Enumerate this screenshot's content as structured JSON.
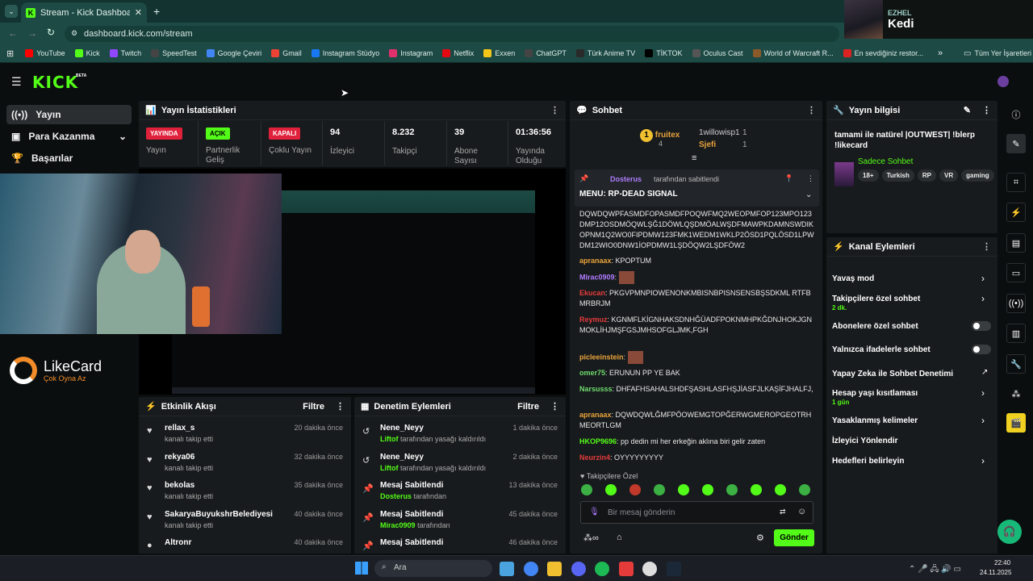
{
  "browser": {
    "tab_title": "Stream - Kick Dashboard",
    "url": "dashboard.kick.com/stream",
    "bookmarks": [
      "YouTube",
      "Kick",
      "Twitch",
      "SpeedTest",
      "Google Çeviri",
      "Gmail",
      "Instagram Stüdyo",
      "Instagram",
      "Netflix",
      "Exxen",
      "ChatGPT",
      "Türk Anime TV",
      "TİKTOK",
      "Oculus Cast",
      "World of Warcraft R...",
      "En sevdiğiniz restor..."
    ],
    "all_bookmarks": "Tüm Yer İşaretleri"
  },
  "media": {
    "artist": "EZHEL",
    "title": "Kedi"
  },
  "kick": {
    "logo": "KICK",
    "beta": "BETA"
  },
  "nav": {
    "items": [
      "Yayın",
      "Para Kazanma",
      "Başarılar"
    ]
  },
  "stats": {
    "title": "Yayın İstatistikleri",
    "badges": [
      {
        "text": "YAYINDA",
        "label": "Yayın"
      },
      {
        "text": "AÇIK",
        "label": "Partnerlik Geliş"
      },
      {
        "text": "KAPALI",
        "label": "Çoklu Yayın"
      }
    ],
    "items": [
      {
        "value": "94",
        "label": "İzleyici"
      },
      {
        "value": "8.232",
        "label": "Takipçi"
      },
      {
        "value": "39",
        "label": "Abone Sayısı"
      },
      {
        "value": "01:36:56",
        "label": "Yayında Olduğu"
      }
    ]
  },
  "overlay": {
    "brand": "LikeCard",
    "tagline": "Çok Oyna  Az"
  },
  "activity": {
    "title": "Etkinlik Akışı",
    "filter": "Filtre",
    "rows": [
      {
        "name": "rellax_s",
        "sub": "kanalı takip etti",
        "time": "20 dakika önce"
      },
      {
        "name": "rekya06",
        "sub": "kanalı takip etti",
        "time": "32 dakika önce"
      },
      {
        "name": "bekolas",
        "sub": "kanalı takip etti",
        "time": "35 dakika önce"
      },
      {
        "name": "SakaryaBuyukshrBelediyesi",
        "sub": "kanalı takip etti",
        "time": "40 dakika önce"
      },
      {
        "name": "Altronr",
        "sub": "",
        "time": "40 dakika önce"
      }
    ]
  },
  "moderation": {
    "title": "Denetim Eylemleri",
    "filter": "Filtre",
    "rows": [
      {
        "name": "Nene_Neyy",
        "actor": "Liftof",
        "sub": "tarafından yasağı kaldırıldı",
        "time": "1 dakika önce"
      },
      {
        "name": "Nene_Neyy",
        "actor": "Liftof",
        "sub": "tarafından yasağı kaldırıldı",
        "time": "2 dakika önce"
      },
      {
        "name": "Mesaj Sabitlendi",
        "actor": "Dosterus",
        "sub": "tarafından",
        "time": "13 dakika önce"
      },
      {
        "name": "Mesaj Sabitlendi",
        "actor": "Mirac0909",
        "sub": "tarafından",
        "time": "45 dakika önce"
      },
      {
        "name": "Mesaj Sabitlendi",
        "actor": "",
        "sub": "",
        "time": "46 dakika önce"
      }
    ]
  },
  "chat": {
    "title": "Sohbet",
    "top": [
      {
        "name": "fruitex",
        "count": "4"
      },
      {
        "name": "1willowisp1",
        "count": "1"
      },
      {
        "name": "Sjefi",
        "count": "1"
      }
    ],
    "pinned": {
      "by": "Dosterus",
      "by_text": "tarafından sabitlendi",
      "text": "MENU: RP-DEAD SIGNAL"
    },
    "messages": [
      {
        "user": "",
        "text": "DQWDQWPFASMDFOPASMDFPOQWFMQ2WEOPMFOP123MPO123DMP12OSDMÖQWLŞĞ1DÖWLQŞDMÖALWŞDFMAWPKDAMNSWDIKOPNM1Q2WO0FIPDMW123FMK1WEDM1WKLP2ÖSD1PQLÖSD1LPWDM12WIO0DNW1İOPDMW1LŞDÖQW2LŞDFÖW2",
        "color": "#e8e8e8"
      },
      {
        "user": "apranaax",
        "text": "KPOPTUM",
        "color": "#e8a33c"
      },
      {
        "user": "Mirac0909",
        "text": "",
        "color": "#b07cff"
      },
      {
        "user": "Ekucan",
        "text": "PKGVPMNPIOWENONKMBISNBPISNSENSBŞSDKML RTFBMRBRJM",
        "color": "#e53b3b"
      },
      {
        "user": "Reymuz",
        "text": "KGNMFLKİGNHAKSDNHĞÜADFPOKNMHPKĞDNJHOKJGNMOKLİHJMŞFGSJMHSOFGLJMK,FGH",
        "color": "#e53b3b"
      },
      {
        "user": "picleeinstein",
        "text": "",
        "color": "#e8a33c"
      },
      {
        "user": "omer75",
        "text": "ERUNUN PP YE BAK",
        "color": "#6fdc6f"
      },
      {
        "user": "Narsusss",
        "text": "DHFAFHSAHALSHDFŞASHLASFHŞJİASFJLKAŞİFJHALFJ,",
        "color": "#6fdc6f"
      },
      {
        "user": "apranaax",
        "text": "DQWDQWLĞMFPÖOWEMGTOPĞERWGMEROPGEOTRHMEORTLGM",
        "color": "#e8a33c"
      },
      {
        "user": "HKOP9696",
        "text": "pp dedin mi her erkeğin aklına biri gelir zaten",
        "color": "#53fc18"
      },
      {
        "user": "Neurzin4",
        "text": "OYYYYYYYYY",
        "color": "#e53b3b"
      }
    ],
    "followers_only": "Takipçilere Özel",
    "placeholder": "Bir mesaj gönderin",
    "send": "Gönder"
  },
  "info": {
    "title": "Yayın bilgisi",
    "stream_title": "tamami ile natürel |OUTWEST| !blerp !likecard",
    "category": "Sadece Sohbet",
    "tags": [
      "18+",
      "Turkish",
      "RP",
      "VR",
      "gaming"
    ]
  },
  "actions": {
    "title": "Kanal Eylemleri",
    "items": [
      {
        "label": "Yavaş mod",
        "sub": ""
      },
      {
        "label": "Takipçilere özel sohbet",
        "sub": "2 dk."
      },
      {
        "label": "Abonelere özel sohbet",
        "sub": ""
      },
      {
        "label": "Yalnızca ifadelerle sohbet",
        "sub": ""
      },
      {
        "label": "Yapay Zeka ile Sohbet Denetimi",
        "sub": ""
      },
      {
        "label": "Hesap yaşı kısıtlaması",
        "sub": "1 gün"
      },
      {
        "label": "Yasaklanmış kelimeler",
        "sub": ""
      },
      {
        "label": "İzleyici Yönlendir",
        "sub": ""
      },
      {
        "label": "Hedefleri belirleyin",
        "sub": ""
      }
    ]
  },
  "taskbar": {
    "search": "Ara",
    "time": "22:40",
    "date": "24.11.2025"
  },
  "colors": {
    "accent": "#53fc18",
    "live": "#e0213c",
    "panel": "#181b1d",
    "bg": "#0b0e0f"
  }
}
